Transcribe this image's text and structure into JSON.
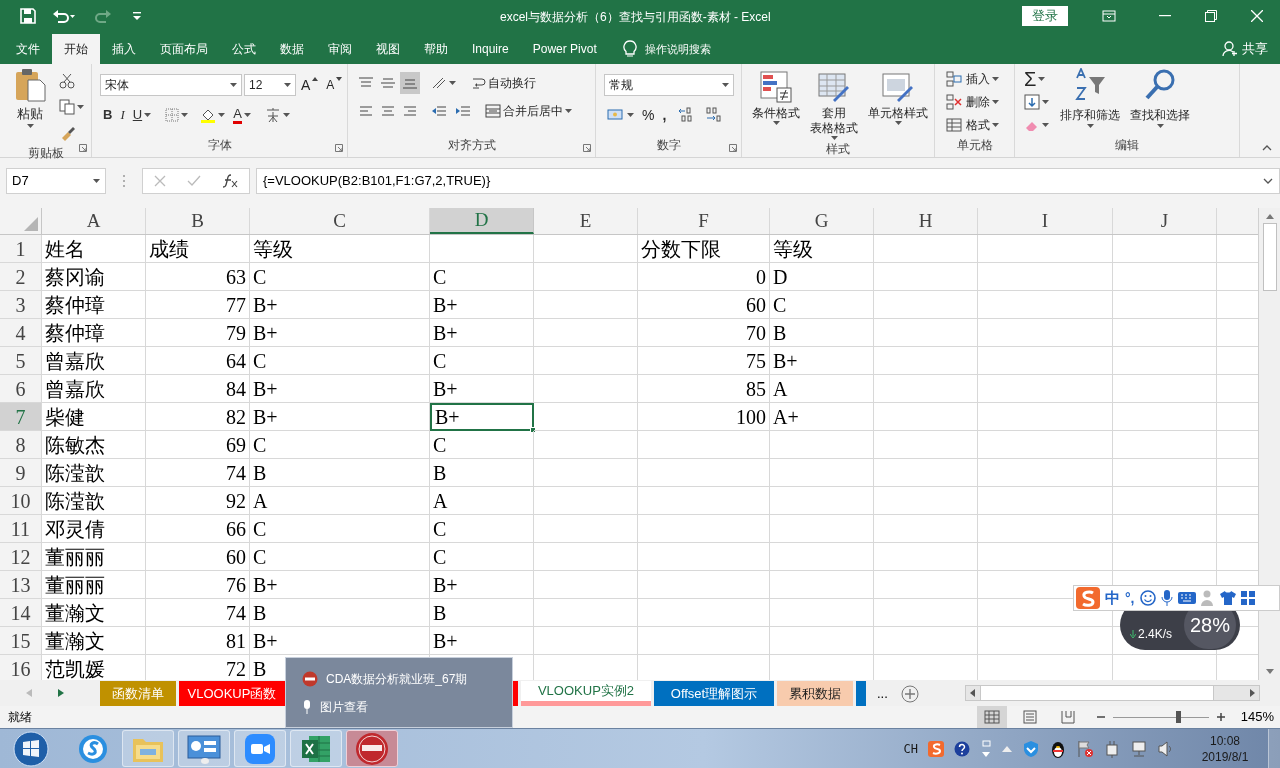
{
  "title_bar": {
    "title": "excel与数据分析（6）查找与引用函数-素材  -  Excel",
    "sign_in": "登录"
  },
  "menu_tabs": [
    {
      "label": "文件",
      "selected": false
    },
    {
      "label": "开始",
      "selected": true
    },
    {
      "label": "插入",
      "selected": false
    },
    {
      "label": "页面布局",
      "selected": false
    },
    {
      "label": "公式",
      "selected": false
    },
    {
      "label": "数据",
      "selected": false
    },
    {
      "label": "审阅",
      "selected": false
    },
    {
      "label": "视图",
      "selected": false
    },
    {
      "label": "帮助",
      "selected": false
    },
    {
      "label": "Inquire",
      "selected": false
    },
    {
      "label": "Power Pivot",
      "selected": false
    }
  ],
  "tell_me": "操作说明搜索",
  "share": "共享",
  "ribbon": {
    "groups": [
      {
        "kind": "clipboard",
        "label": "剪贴板",
        "launcher": true,
        "paste": "粘贴"
      },
      {
        "kind": "font",
        "label": "字体",
        "launcher": true,
        "font_name": "宋体",
        "font_size": "12",
        "grow": "A",
        "shrink": "A",
        "bold": "B",
        "italic": "I",
        "underline": "U",
        "font_color": "A"
      },
      {
        "kind": "alignment",
        "label": "对齐方式",
        "launcher": true,
        "wrap_text": "自动换行",
        "merge_center": "合并后居中"
      },
      {
        "kind": "number",
        "label": "数字",
        "launcher": true,
        "format": "常规",
        "percent": "%",
        "comma": ","
      },
      {
        "kind": "styles",
        "label": "样式",
        "launcher": false,
        "buttons": [
          {
            "lines": [
              "条件格式"
            ]
          },
          {
            "lines": [
              "套用",
              "表格格式"
            ]
          },
          {
            "lines": [
              "单元格样式"
            ]
          }
        ]
      },
      {
        "kind": "cells",
        "label": "单元格",
        "launcher": false,
        "buttons": [
          "插入",
          "删除",
          "格式"
        ]
      },
      {
        "kind": "editing",
        "label": "编辑",
        "launcher": false,
        "sum": "Σ",
        "buttons": [
          "排序和筛选",
          "查找和选择"
        ]
      }
    ]
  },
  "formula_bar": {
    "name_box": "D7",
    "formula": "{=VLOOKUP(B2:B101,F1:G7,2,TRUE)}"
  },
  "columns": [
    {
      "letter": "A",
      "selected": false
    },
    {
      "letter": "B",
      "selected": false
    },
    {
      "letter": "C",
      "selected": false
    },
    {
      "letter": "D",
      "selected": true
    },
    {
      "letter": "E",
      "selected": false
    },
    {
      "letter": "F",
      "selected": false
    },
    {
      "letter": "G",
      "selected": false
    },
    {
      "letter": "H",
      "selected": false
    },
    {
      "letter": "I",
      "selected": false
    },
    {
      "letter": "J",
      "selected": false
    }
  ],
  "rows": [
    {
      "number": "1",
      "kind": "header",
      "selected": false,
      "a": "姓名",
      "b": "成绩",
      "c": "等级",
      "f": "分数下限",
      "g": "等级"
    },
    {
      "number": "2",
      "kind": "data",
      "selected": false,
      "a": "蔡冈谕",
      "b": "63",
      "c": "C",
      "d": "C",
      "f": "0",
      "g": "D"
    },
    {
      "number": "3",
      "kind": "data",
      "selected": false,
      "a": "蔡仲璋",
      "b": "77",
      "c": "B+",
      "d": "B+",
      "f": "60",
      "g": "C"
    },
    {
      "number": "4",
      "kind": "data",
      "selected": false,
      "a": "蔡仲璋",
      "b": "79",
      "c": "B+",
      "d": "B+",
      "f": "70",
      "g": "B"
    },
    {
      "number": "5",
      "kind": "data",
      "selected": false,
      "a": "曾嘉欣",
      "b": "64",
      "c": "C",
      "d": "C",
      "f": "75",
      "g": "B+"
    },
    {
      "number": "6",
      "kind": "data",
      "selected": false,
      "a": "曾嘉欣",
      "b": "84",
      "c": "B+",
      "d": "B+",
      "f": "85",
      "g": "A"
    },
    {
      "number": "7",
      "kind": "data",
      "selected": true,
      "a": "柴健",
      "b": "82",
      "c": "B+",
      "d": "B+",
      "f": "100",
      "g": "A+"
    },
    {
      "number": "8",
      "kind": "data",
      "selected": false,
      "a": "陈敏杰",
      "b": "69",
      "c": "C",
      "d": "C"
    },
    {
      "number": "9",
      "kind": "data",
      "selected": false,
      "a": "陈滢歆",
      "b": "74",
      "c": "B",
      "d": "B"
    },
    {
      "number": "10",
      "kind": "data",
      "selected": false,
      "a": "陈滢歆",
      "b": "92",
      "c": "A",
      "d": "A"
    },
    {
      "number": "11",
      "kind": "data",
      "selected": false,
      "a": "邓灵倩",
      "b": "66",
      "c": "C",
      "d": "C"
    },
    {
      "number": "12",
      "kind": "data",
      "selected": false,
      "a": "董丽丽",
      "b": "60",
      "c": "C",
      "d": "C"
    },
    {
      "number": "13",
      "kind": "data",
      "selected": false,
      "a": "董丽丽",
      "b": "76",
      "c": "B+",
      "d": "B+"
    },
    {
      "number": "14",
      "kind": "data",
      "selected": false,
      "a": "董瀚文",
      "b": "74",
      "c": "B",
      "d": "B"
    },
    {
      "number": "15",
      "kind": "data",
      "selected": false,
      "a": "董瀚文",
      "b": "81",
      "c": "B+",
      "d": "B+"
    },
    {
      "number": "16",
      "kind": "data",
      "selected": false,
      "a": "范凯媛",
      "b": "72",
      "c": "B"
    }
  ],
  "sheet_tabs": [
    {
      "label": "函数清单",
      "color": "#c09100",
      "selected": false
    },
    {
      "label": "VLOOKUP函数",
      "color": "#ff0000",
      "selected": false
    },
    {
      "color": "#ff0000",
      "selected": false
    },
    {
      "label": "VLOOKUP实例2",
      "color": "#ff9999",
      "selected": true
    },
    {
      "label": "Offset理解图示",
      "color": "#0070c0",
      "selected": false
    },
    {
      "label": "累积数据",
      "color": "#f8cbad",
      "selected": false
    },
    {
      "color": "#0070c0",
      "selected": false
    }
  ],
  "more_tabs": "...",
  "popup": {
    "items": [
      {
        "kind": "app",
        "label": "CDA数据分析就业班_67期"
      },
      {
        "kind": "pin",
        "label": "图片查看"
      }
    ]
  },
  "status_bar": {
    "status": "就绪",
    "views": [
      {
        "kind": "normal",
        "selected": true
      },
      {
        "kind": "page_layout",
        "selected": false
      },
      {
        "kind": "page_break",
        "selected": false
      }
    ],
    "zoom": {
      "level": 0.68,
      "reading": "145%"
    }
  },
  "ime_bar": {
    "mode": "中",
    "punct": "°,"
  },
  "net_widget": {
    "speed": "2.4K/s",
    "percent": "28%"
  },
  "taskbar": {
    "apps": [
      {
        "kind": "browser",
        "selected": false
      },
      {
        "kind": "folder",
        "selected": false
      },
      {
        "kind": "remote",
        "selected": false
      },
      {
        "kind": "video",
        "selected": false
      },
      {
        "kind": "spreadsheet",
        "selected": false
      },
      {
        "kind": "cda",
        "selected": true
      }
    ],
    "language": "CH",
    "time": "10:08",
    "date": "2019/8/1"
  }
}
